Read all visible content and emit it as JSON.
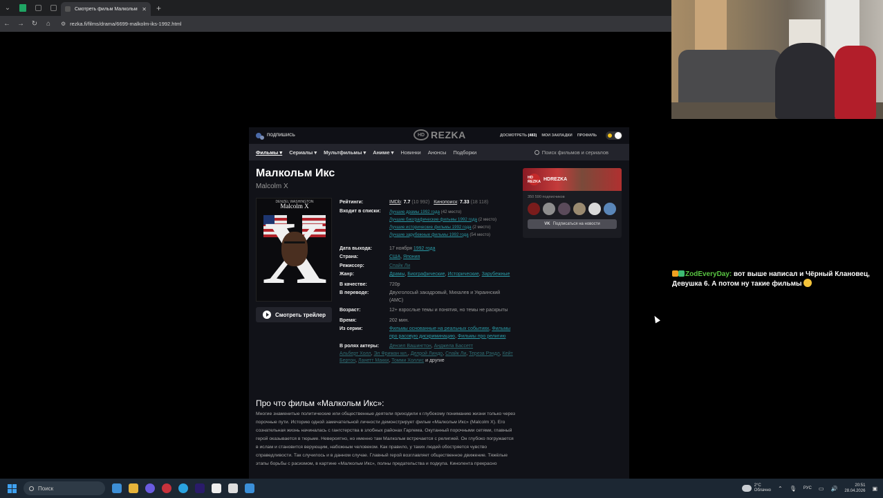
{
  "browser": {
    "tab_title": "Смотреть фильм Малкольм Икс",
    "url": "rezka.fi/films/drama/6699-malkolm-iks-1992.html"
  },
  "site": {
    "subscribe_label": "ПОДПИШИСЬ",
    "logo_hd": "HD",
    "logo_text": "REZKA",
    "top_links": {
      "watched_label": "ДОСМОТРЕТЬ",
      "watched_count": "(483)",
      "bookmarks": "МОИ ЗАКЛАДКИ",
      "profile": "ПРОФИЛЬ"
    },
    "nav": [
      {
        "label": "Фильмы ▾"
      },
      {
        "label": "Сериалы ▾"
      },
      {
        "label": "Мультфильмы ▾"
      },
      {
        "label": "Аниме ▾"
      },
      {
        "label": "Новинки"
      },
      {
        "label": "Анонсы"
      },
      {
        "label": "Подборки"
      }
    ],
    "search_placeholder": "Поиск фильмов и сериалов"
  },
  "movie": {
    "title": "Малкольм Икс",
    "original_title": "Malcolm X",
    "poster": {
      "credit": "DENZEL WASHINGTON",
      "subtitle": "SPIKE LEE",
      "name": "Malcolm X",
      "letter": "X"
    },
    "trailer_label": "Смотреть трейлер",
    "labels": {
      "ratings": "Рейтинги:",
      "lists": "Входит в списки:",
      "release": "Дата выхода:",
      "country": "Страна:",
      "director": "Режиссер:",
      "genre": "Жанр:",
      "quality": "В качестве:",
      "translation": "В переводе:",
      "age": "Возраст:",
      "duration": "Время:",
      "series": "Из серии:",
      "cast": "В ролях актеры:"
    },
    "ratings": {
      "imdb_name": "IMDb",
      "imdb_value": "7.7",
      "imdb_count": "(10 992)",
      "kp_name": "Кинопоиск",
      "kp_value": "7.33",
      "kp_count": "(18 118)"
    },
    "lists": [
      {
        "name": "Лучшие драмы 1992 года",
        "place": "(42 место)"
      },
      {
        "name": "Лучшие биографические фильмы 1992 года",
        "place": "(2 место)"
      },
      {
        "name": "Лучшие исторические фильмы 1992 года",
        "place": "(2 место)"
      },
      {
        "name": "Лучшие зарубежные фильмы 1992 года",
        "place": "(54 место)"
      }
    ],
    "release_date": "17 ноября",
    "release_year": "1992 года",
    "countries": [
      "США",
      "Япония"
    ],
    "director": "Спайк Ли",
    "genres": [
      "Драмы",
      "Биографические",
      "Исторические",
      "Зарубежные"
    ],
    "quality": "720p",
    "translation": "Двухголосый закадровый, Михалев и Украинский (AMC)",
    "age": "12+ взрослые темы и понятия, но темы не раскрыты",
    "duration": "202 мин.",
    "series": [
      "Фильмы основанные на реальных событиях",
      "Фильмы про расовую дискриминацию",
      "Фильмы про религию"
    ],
    "cast": [
      "Дензел Вашингтон",
      "Анджела Бассетт",
      "Альберт Холл",
      "Эл Фриман мл.",
      "Делрой Линдо",
      "Спайк Ли",
      "Тереза Рэндл",
      "Кейт Бертон",
      "Ланетт Макки",
      "Томми Холлис"
    ],
    "cast_more": "и другие",
    "about_title": "Про что фильм «Малкольм Икс»:",
    "about_text": "Многие знаменитые политические или общественные деятели приходили к глубокому пониманию жизни только через порочные пути. Историю одной замечательной личности демонстрирует фильм «Малкольм Икс» (Malcolm X). Его сознательная жизнь начиналась с гангстерства в злобных районах Гарлема. Окутанный порочными сетями, главный герой оказывается в тюрьме. Невероятно, но именно там Малкольм встречается с религией. Он глубоко погружается в ислам и становится верующим, набожным человеком. Как правило, у таких людей обостряется чувство справедливости. Так случилось и в данном случае. Главный герой возглавляет общественное движение. Тяжёлые этапы борьбы с расизмом, в картине «Малкольм Икс», полны предательства и подкупа. Кинолента прекрасно"
  },
  "vk_widget": {
    "avatar": "HD REZKA",
    "name": "HDREZKA",
    "subscribers": "350 590 подписчиков",
    "button_label": "Подписаться на новости",
    "vk_logo": "VK",
    "face_colors": [
      "#7a1c1c",
      "#8d8d8d",
      "#5a4a5a",
      "#9a8a70",
      "#d9d9d9",
      "#5a86b8"
    ]
  },
  "chat": {
    "user": "ZodEveryDay:",
    "message": "вот выше написал и Чёрный Клановец, Девушка 6. А потом ну такие фильмы"
  },
  "taskbar": {
    "search_label": "Поиск",
    "language": "РУС",
    "weather_temp": "2°C",
    "weather_desc": "Облачно",
    "time": "20:51",
    "date": "28.04.2026"
  }
}
